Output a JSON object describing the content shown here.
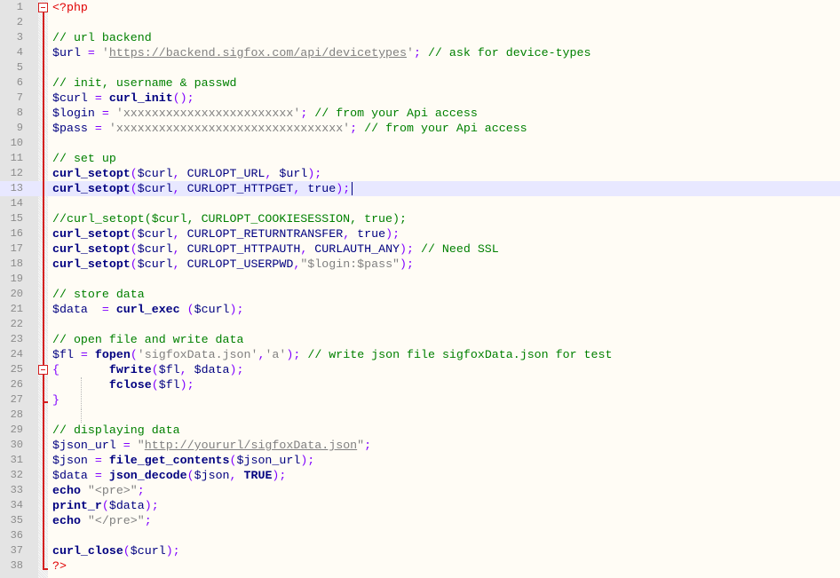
{
  "editor": {
    "language": "php",
    "current_line": 13,
    "colors": {
      "background": "#fffcf5",
      "current_line": "#e8e8ff",
      "gutter": "#e4e4e4",
      "fold_marker": "#d42020",
      "php_tag": "#e00000",
      "comment": "#008000",
      "keyword": "#000080",
      "operator": "#8000ff",
      "string": "#808080"
    },
    "lines": [
      {
        "n": "1",
        "tokens": [
          [
            "php",
            "<?php"
          ]
        ]
      },
      {
        "n": "2",
        "tokens": []
      },
      {
        "n": "3",
        "tokens": [
          [
            "comment",
            "// url backend"
          ]
        ]
      },
      {
        "n": "4",
        "tokens": [
          [
            "var",
            "$url"
          ],
          [
            "op",
            " = "
          ],
          [
            "str",
            "'"
          ],
          [
            "url",
            "https://backend.sigfox.com/api/devicetypes"
          ],
          [
            "str",
            "'"
          ],
          [
            "op",
            ";"
          ],
          [
            "comment",
            " // ask for device-types"
          ]
        ]
      },
      {
        "n": "5",
        "tokens": []
      },
      {
        "n": "6",
        "tokens": [
          [
            "comment",
            "// init, username & passwd"
          ]
        ]
      },
      {
        "n": "7",
        "tokens": [
          [
            "var",
            "$curl"
          ],
          [
            "op",
            " = "
          ],
          [
            "func",
            "curl_init"
          ],
          [
            "op",
            "();"
          ]
        ]
      },
      {
        "n": "8",
        "tokens": [
          [
            "var",
            "$login"
          ],
          [
            "op",
            " = "
          ],
          [
            "str",
            "'xxxxxxxxxxxxxxxxxxxxxxxx'"
          ],
          [
            "op",
            ";"
          ],
          [
            "comment",
            " // from your Api access"
          ]
        ]
      },
      {
        "n": "9",
        "tokens": [
          [
            "var",
            "$pass"
          ],
          [
            "op",
            " = "
          ],
          [
            "str",
            "'xxxxxxxxxxxxxxxxxxxxxxxxxxxxxxxx'"
          ],
          [
            "op",
            ";"
          ],
          [
            "comment",
            " // from your Api access"
          ]
        ]
      },
      {
        "n": "10",
        "tokens": []
      },
      {
        "n": "11",
        "tokens": [
          [
            "comment",
            "// set up"
          ]
        ]
      },
      {
        "n": "12",
        "tokens": [
          [
            "func",
            "curl_setopt"
          ],
          [
            "op",
            "("
          ],
          [
            "var",
            "$curl"
          ],
          [
            "op",
            ", "
          ],
          [
            "const",
            "CURLOPT_URL"
          ],
          [
            "op",
            ", "
          ],
          [
            "var",
            "$url"
          ],
          [
            "op",
            ");"
          ]
        ]
      },
      {
        "n": "13",
        "tokens": [
          [
            "func",
            "curl_setopt"
          ],
          [
            "op",
            "("
          ],
          [
            "var",
            "$curl"
          ],
          [
            "op",
            ", "
          ],
          [
            "const",
            "CURLOPT_HTTPGET"
          ],
          [
            "op",
            ", "
          ],
          [
            "plain",
            "true"
          ],
          [
            "op",
            ");"
          ]
        ]
      },
      {
        "n": "14",
        "tokens": []
      },
      {
        "n": "15",
        "tokens": [
          [
            "comment",
            "//curl_setopt($curl, CURLOPT_COOKIESESSION, true);"
          ]
        ]
      },
      {
        "n": "16",
        "tokens": [
          [
            "func",
            "curl_setopt"
          ],
          [
            "op",
            "("
          ],
          [
            "var",
            "$curl"
          ],
          [
            "op",
            ", "
          ],
          [
            "const",
            "CURLOPT_RETURNTRANSFER"
          ],
          [
            "op",
            ", "
          ],
          [
            "plain",
            "true"
          ],
          [
            "op",
            ");"
          ]
        ]
      },
      {
        "n": "17",
        "tokens": [
          [
            "func",
            "curl_setopt"
          ],
          [
            "op",
            "("
          ],
          [
            "var",
            "$curl"
          ],
          [
            "op",
            ", "
          ],
          [
            "const",
            "CURLOPT_HTTPAUTH"
          ],
          [
            "op",
            ", "
          ],
          [
            "const",
            "CURLAUTH_ANY"
          ],
          [
            "op",
            ");"
          ],
          [
            "comment",
            " // Need SSL"
          ]
        ]
      },
      {
        "n": "18",
        "tokens": [
          [
            "func",
            "curl_setopt"
          ],
          [
            "op",
            "("
          ],
          [
            "var",
            "$curl"
          ],
          [
            "op",
            ", "
          ],
          [
            "const",
            "CURLOPT_USERPWD"
          ],
          [
            "op",
            ","
          ],
          [
            "str",
            "\"$login:$pass\""
          ],
          [
            "op",
            ");"
          ]
        ]
      },
      {
        "n": "19",
        "tokens": []
      },
      {
        "n": "20",
        "tokens": [
          [
            "comment",
            "// store data"
          ]
        ]
      },
      {
        "n": "21",
        "tokens": [
          [
            "var",
            "$data"
          ],
          [
            "op",
            "  = "
          ],
          [
            "func",
            "curl_exec"
          ],
          [
            "op",
            " ("
          ],
          [
            "var",
            "$curl"
          ],
          [
            "op",
            ");"
          ]
        ]
      },
      {
        "n": "22",
        "tokens": []
      },
      {
        "n": "23",
        "tokens": [
          [
            "comment",
            "// open file and write data"
          ]
        ]
      },
      {
        "n": "24",
        "tokens": [
          [
            "var",
            "$fl"
          ],
          [
            "op",
            " = "
          ],
          [
            "func",
            "fopen"
          ],
          [
            "op",
            "("
          ],
          [
            "str",
            "'sigfoxData.json'"
          ],
          [
            "op",
            ","
          ],
          [
            "str",
            "'a'"
          ],
          [
            "op",
            ");"
          ],
          [
            "comment",
            " // write json file sigfoxData.json for test"
          ]
        ]
      },
      {
        "n": "25",
        "tokens": [
          [
            "op",
            "{       "
          ],
          [
            "func",
            "fwrite"
          ],
          [
            "op",
            "("
          ],
          [
            "var",
            "$fl"
          ],
          [
            "op",
            ", "
          ],
          [
            "var",
            "$data"
          ],
          [
            "op",
            ");"
          ]
        ]
      },
      {
        "n": "26",
        "tokens": [
          [
            "plain",
            "        "
          ],
          [
            "func",
            "fclose"
          ],
          [
            "op",
            "("
          ],
          [
            "var",
            "$fl"
          ],
          [
            "op",
            ");"
          ]
        ]
      },
      {
        "n": "27",
        "tokens": [
          [
            "op",
            "}"
          ]
        ]
      },
      {
        "n": "28",
        "tokens": []
      },
      {
        "n": "29",
        "tokens": [
          [
            "comment",
            "// displaying data"
          ]
        ]
      },
      {
        "n": "30",
        "tokens": [
          [
            "var",
            "$json_url"
          ],
          [
            "op",
            " = "
          ],
          [
            "str",
            "\""
          ],
          [
            "url",
            "http://yoururl/sigfoxData.json"
          ],
          [
            "str",
            "\""
          ],
          [
            "op",
            ";"
          ]
        ]
      },
      {
        "n": "31",
        "tokens": [
          [
            "var",
            "$json"
          ],
          [
            "op",
            " = "
          ],
          [
            "func",
            "file_get_contents"
          ],
          [
            "op",
            "("
          ],
          [
            "var",
            "$json_url"
          ],
          [
            "op",
            ");"
          ]
        ]
      },
      {
        "n": "32",
        "tokens": [
          [
            "var",
            "$data"
          ],
          [
            "op",
            " = "
          ],
          [
            "func",
            "json_decode"
          ],
          [
            "op",
            "("
          ],
          [
            "var",
            "$json"
          ],
          [
            "op",
            ", "
          ],
          [
            "func",
            "TRUE"
          ],
          [
            "op",
            ");"
          ]
        ]
      },
      {
        "n": "33",
        "tokens": [
          [
            "func",
            "echo"
          ],
          [
            "plain",
            " "
          ],
          [
            "str",
            "\"<pre>\""
          ],
          [
            "op",
            ";"
          ]
        ]
      },
      {
        "n": "34",
        "tokens": [
          [
            "func",
            "print_r"
          ],
          [
            "op",
            "("
          ],
          [
            "var",
            "$data"
          ],
          [
            "op",
            ");"
          ]
        ]
      },
      {
        "n": "35",
        "tokens": [
          [
            "func",
            "echo"
          ],
          [
            "plain",
            " "
          ],
          [
            "str",
            "\"</pre>\""
          ],
          [
            "op",
            ";"
          ]
        ]
      },
      {
        "n": "36",
        "tokens": []
      },
      {
        "n": "37",
        "tokens": [
          [
            "func",
            "curl_close"
          ],
          [
            "op",
            "("
          ],
          [
            "var",
            "$curl"
          ],
          [
            "op",
            ");"
          ]
        ]
      },
      {
        "n": "38",
        "tokens": [
          [
            "php",
            "?>"
          ]
        ]
      }
    ]
  }
}
